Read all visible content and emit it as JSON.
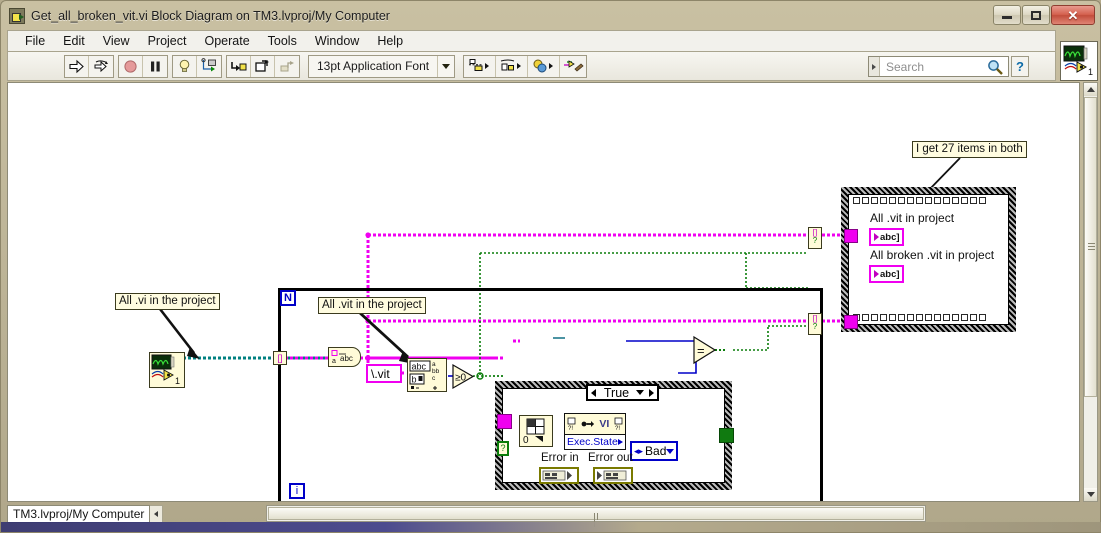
{
  "window": {
    "title": "Get_all_broken_vit.vi Block Diagram on TM3.lvproj/My Computer",
    "icon": "labview-vi-icon",
    "buttons": {
      "minimize": "minimize-icon",
      "maximize": "maximize-icon",
      "close": "✕"
    }
  },
  "menubar": {
    "items": [
      {
        "label": "File"
      },
      {
        "label": "Edit"
      },
      {
        "label": "View"
      },
      {
        "label": "Project"
      },
      {
        "label": "Operate"
      },
      {
        "label": "Tools"
      },
      {
        "label": "Window"
      },
      {
        "label": "Help"
      }
    ]
  },
  "toolbar": {
    "run": "run-arrow-icon",
    "run_continuously": "run-continuously-icon",
    "abort": "abort-execution-icon",
    "pause": "pause-icon",
    "highlight_execution": "lightbulb-icon",
    "retain_wire_values": "retain-wire-values-icon",
    "step_into": "step-into-icon",
    "step_over": "step-over-icon",
    "step_out": "step-out-icon",
    "font_label": "13pt Application Font",
    "font_caret": "chevron-down-icon",
    "align_objects": "align-objects-icon",
    "distribute_objects": "distribute-objects-icon",
    "reorder": "reorder-icon",
    "clean_up_diagram": "clean-up-diagram-icon",
    "search_placeholder": "Search",
    "search_icon": "magnifier-icon",
    "help_label": "?",
    "vi_icon": "vi-icon-1"
  },
  "diagram": {
    "comments": [
      {
        "id": "comment-all-vi",
        "text": "All .vi in the project"
      },
      {
        "id": "comment-all-vit",
        "text": "All .vit in the project"
      },
      {
        "id": "comment-27-items",
        "text": "I get 27 items in both"
      }
    ],
    "for_loop": {
      "count_terminal": "N",
      "iteration_terminal": "i"
    },
    "case_structure": {
      "selector_value": "True",
      "selector_left_arrow": "chevron-left-icon",
      "selector_right_arrow": "chevron-right-icon",
      "selector_caret": "chevron-down-icon"
    },
    "nodes": [
      {
        "id": "subvi-get-all-vis",
        "type": "subvi",
        "badge": "1"
      },
      {
        "id": "array-to-spreadsheet-string",
        "type": "conversion"
      },
      {
        "id": "search-split-string",
        "type": "string-function"
      },
      {
        "id": "greater-than-zero",
        "type": "comparison",
        "label": "≥0"
      },
      {
        "id": "index-array",
        "type": "array-function",
        "index_label": "0"
      },
      {
        "id": "property-node-vi",
        "type": "property-node",
        "class_label": "VI",
        "property": "Exec.State"
      },
      {
        "id": "equal-comparison",
        "type": "comparison",
        "label": "="
      }
    ],
    "constants": [
      {
        "id": "string-constant-vit",
        "value": "\\.vit",
        "kind": "string"
      },
      {
        "id": "enum-constant-bad",
        "value": "Bad",
        "kind": "enum"
      }
    ],
    "indicators": [
      {
        "id": "indicator-all-vit",
        "label": "All .vit in project",
        "terminal": "abc-array-terminal"
      },
      {
        "id": "indicator-all-broken-vit",
        "label": "All broken .vit in project",
        "terminal": "abc-array-terminal"
      }
    ],
    "error_cluster": {
      "error_in_label": "Error in",
      "error_out_label": "Error out"
    },
    "tunnels": {
      "conditional_marker_bracket": "[]",
      "conditional_marker_question": "?"
    },
    "colors": {
      "string_wire": "#f000f0",
      "boolean_wire": "#0a7d0a",
      "string_array_wire": "#008080",
      "numeric_wire": "#0000c8",
      "node_fill": "#fffbd8",
      "comment_fill": "#fffce0"
    }
  },
  "statusbar": {
    "context": "TM3.lvproj/My Computer",
    "collapse_icon": "chevron-left-icon"
  }
}
